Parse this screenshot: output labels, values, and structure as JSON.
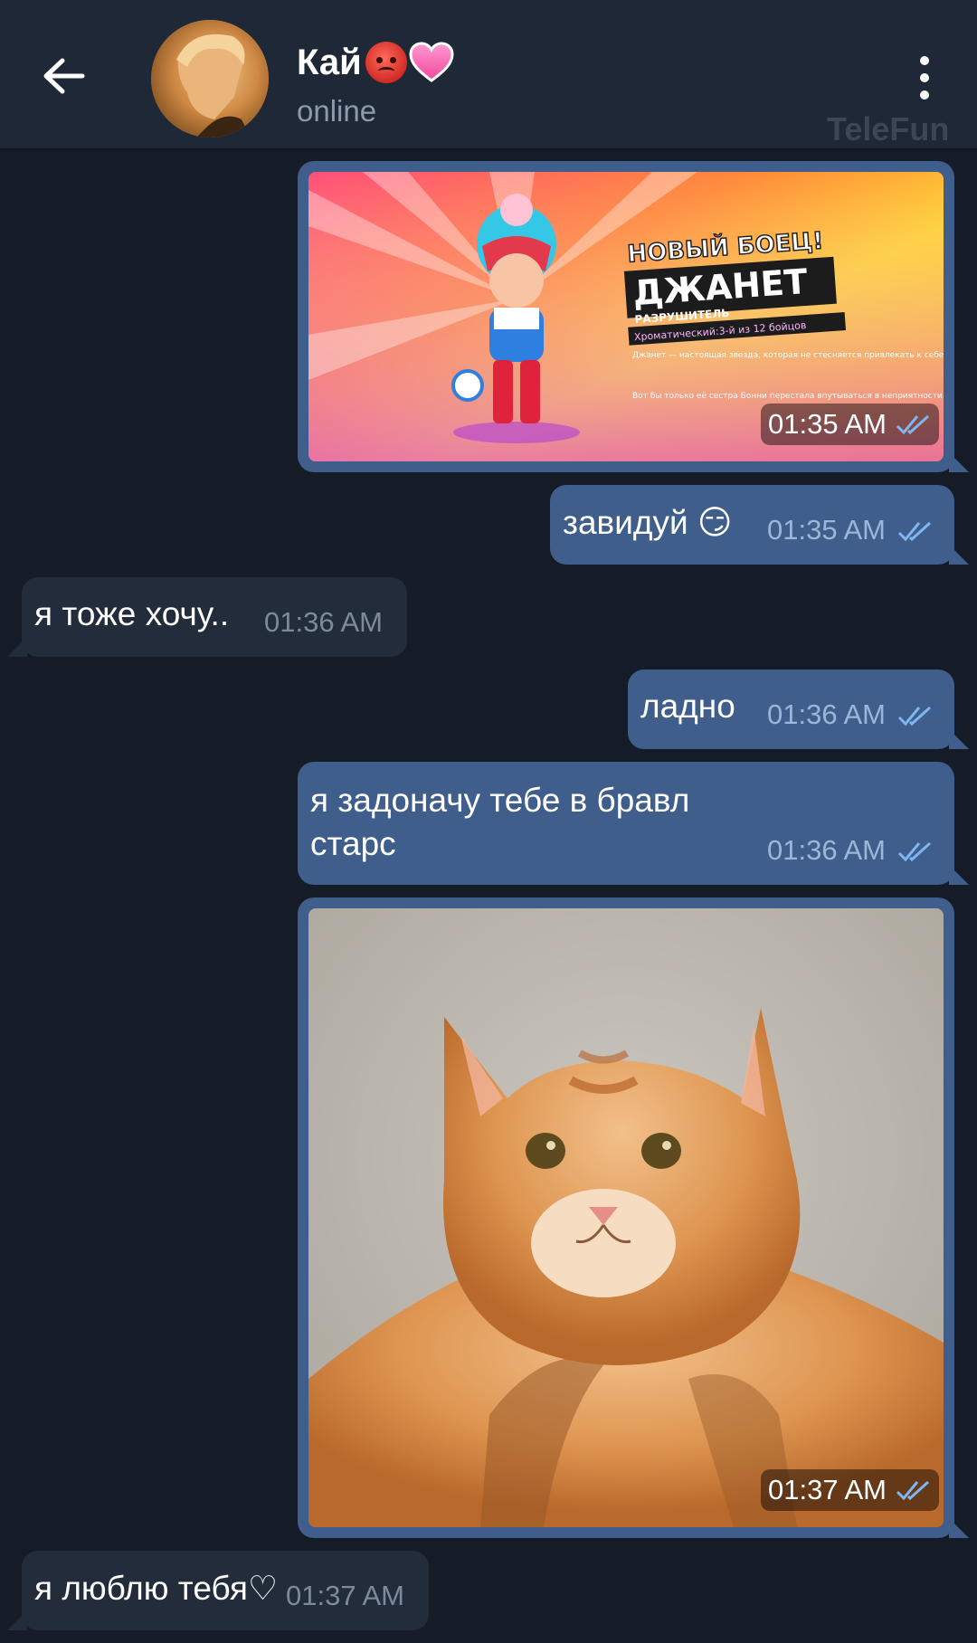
{
  "header": {
    "contact_name": "Кай",
    "status": "online",
    "watermark": "TeleFun"
  },
  "messages": [
    {
      "direction": "outgoing",
      "type": "image",
      "image": {
        "title_line1": "НОВЫЙ БОЕЦ!",
        "title_line2": "ДЖАНЕТ",
        "subtitle": "РАЗРУШИТЕЛЬ",
        "rarity": "Хроматический:3-й из 12 бойцов",
        "desc1": "Джанет — настоящая звезда, которая не стесняется привлекать к себе внимание.",
        "desc2": "Вот бы только её сестра Бонни перестала впутываться в неприятности..."
      },
      "time": "01:35 AM",
      "read": true
    },
    {
      "direction": "outgoing",
      "type": "text",
      "text": "завидуй 😏",
      "time": "01:35 AM",
      "read": true
    },
    {
      "direction": "incoming",
      "type": "text",
      "text": "я тоже хочу..",
      "time": "01:36 AM"
    },
    {
      "direction": "outgoing",
      "type": "text",
      "text": "ладно",
      "time": "01:36 AM",
      "read": true
    },
    {
      "direction": "outgoing",
      "type": "text",
      "text_line1": "я задоначу тебе в бравл",
      "text_line2": "старс",
      "time": "01:36 AM",
      "read": true
    },
    {
      "direction": "outgoing",
      "type": "image",
      "image_subject": "cat",
      "time": "01:37 AM",
      "read": true
    },
    {
      "direction": "incoming",
      "type": "text",
      "text": "я люблю тебя♡",
      "time": "01:37 AM"
    }
  ],
  "colors": {
    "background": "#151c27",
    "header": "#1f2836",
    "outgoing_bubble": "#3f5e8c",
    "incoming_bubble": "#222c3b",
    "read_check": "#7fb6f0"
  }
}
